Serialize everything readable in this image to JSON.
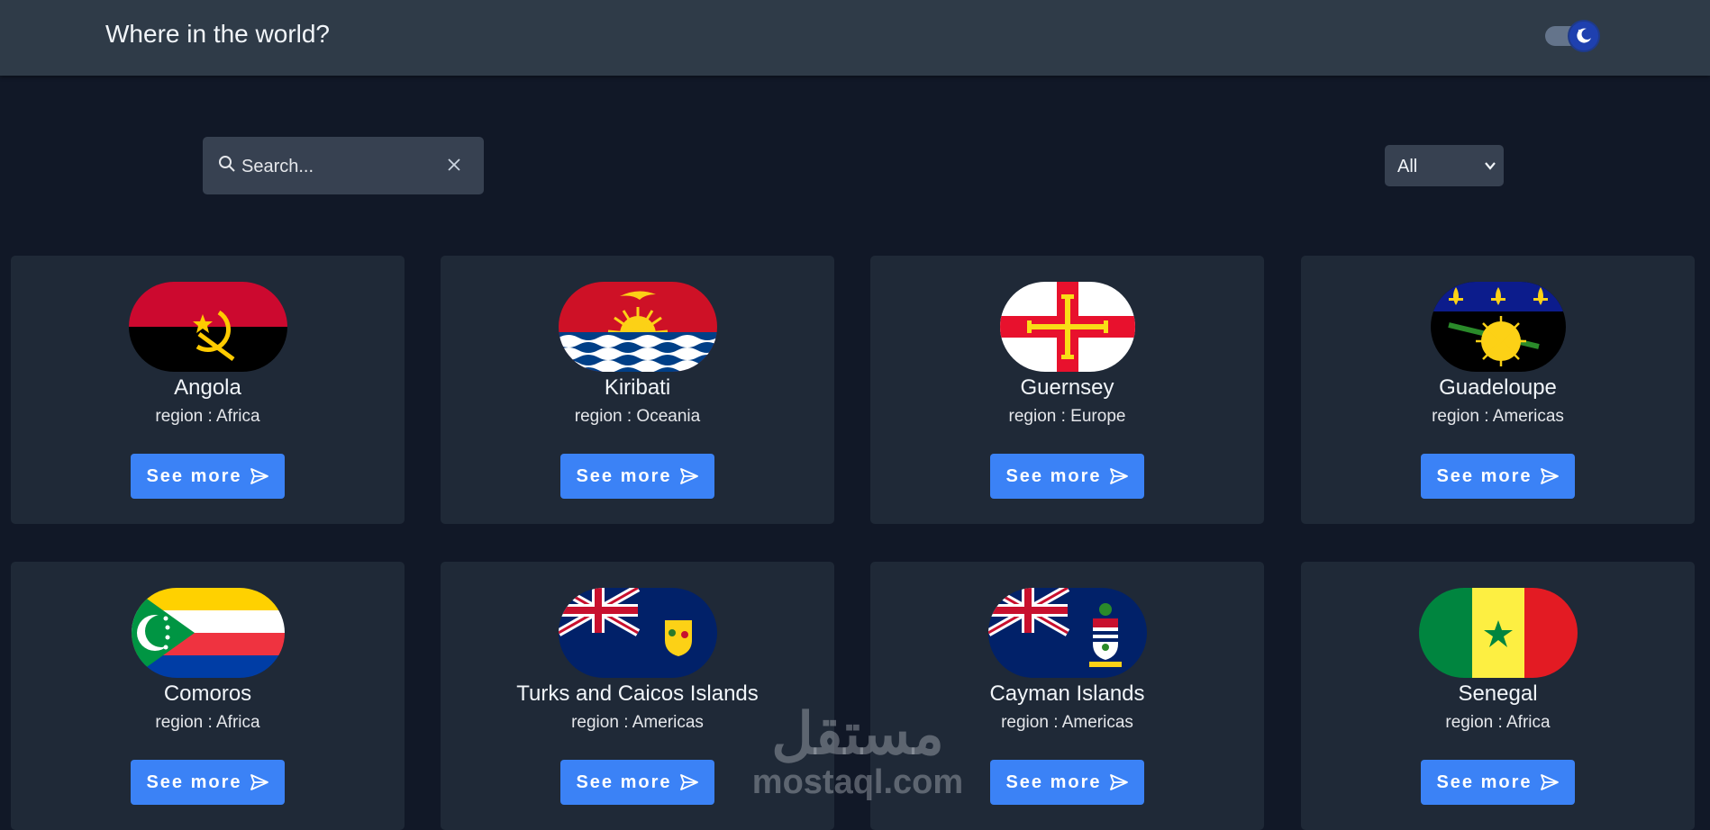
{
  "header": {
    "title": "Where in the world?",
    "theme_toggle_icon": "moon-icon",
    "background": "#2f3b48"
  },
  "search": {
    "placeholder": "Search...",
    "value": "",
    "search_icon": "search-icon",
    "clear_icon": "close-icon"
  },
  "filter": {
    "selected": "All",
    "icon": "chevron-down-icon"
  },
  "theme": {
    "page_background": "#111827",
    "card_background": "#1f2937",
    "accent": "#3b82f6"
  },
  "countries": [
    {
      "name": "Angola",
      "region": "region : Africa",
      "button": "See more",
      "flag_icon": "angola-flag-icon"
    },
    {
      "name": "Kiribati",
      "region": "region : Oceania",
      "button": "See more",
      "flag_icon": "kiribati-flag-icon"
    },
    {
      "name": "Guernsey",
      "region": "region : Europe",
      "button": "See more",
      "flag_icon": "guernsey-flag-icon"
    },
    {
      "name": "Guadeloupe",
      "region": "region : Americas",
      "button": "See more",
      "flag_icon": "guadeloupe-flag-icon"
    },
    {
      "name": "Comoros",
      "region": "region : Africa",
      "button": "See more",
      "flag_icon": "comoros-flag-icon"
    },
    {
      "name": "Turks and Caicos Islands",
      "region": "region : Americas",
      "button": "See more",
      "flag_icon": "turks-caicos-flag-icon"
    },
    {
      "name": "Cayman Islands",
      "region": "region : Americas",
      "button": "See more",
      "flag_icon": "cayman-flag-icon"
    },
    {
      "name": "Senegal",
      "region": "region : Africa",
      "button": "See more",
      "flag_icon": "senegal-flag-icon"
    }
  ],
  "watermark": {
    "logo": "مستقل",
    "url": "mostaql.com"
  }
}
